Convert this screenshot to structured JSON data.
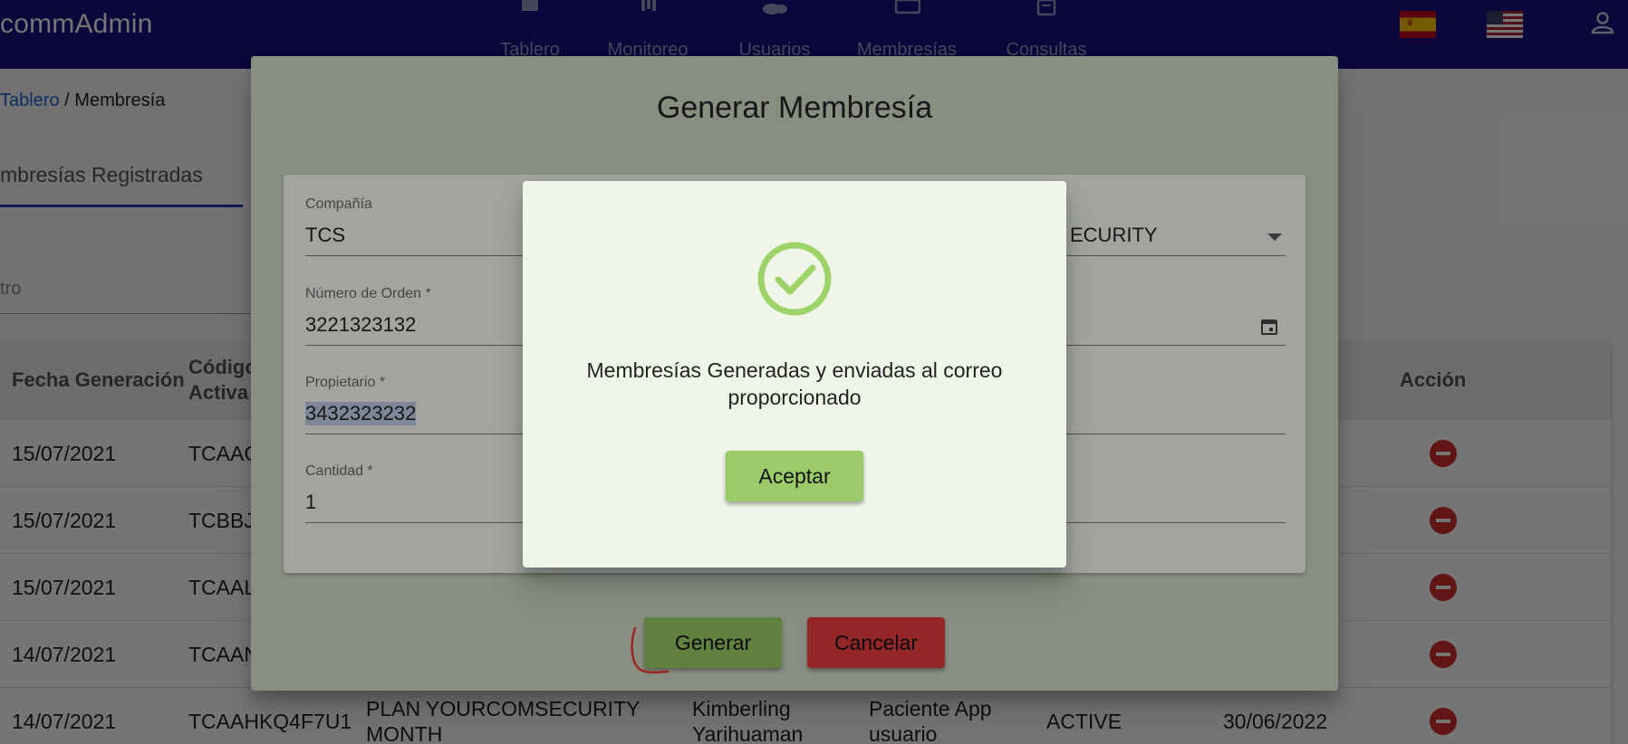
{
  "appbar": {
    "brand": "commAdmin",
    "nav": [
      {
        "label": "Tablero",
        "icon": "home-icon"
      },
      {
        "label": "Monitoreo",
        "icon": "bar-chart-icon"
      },
      {
        "label": "Usuarios",
        "icon": "people-icon"
      },
      {
        "label": "Membresías",
        "icon": "card-icon"
      },
      {
        "label": "Consultas",
        "icon": "clipboard-icon"
      }
    ],
    "languages": [
      {
        "name": "es",
        "icon": "spain-flag-icon"
      },
      {
        "name": "en",
        "icon": "usa-flag-icon"
      }
    ],
    "user_icon": "account-icon",
    "color": "#1a1080"
  },
  "breadcrumb": {
    "link": "Tablero",
    "separator": " / ",
    "current": "Membresía"
  },
  "page": {
    "tab_label": "mbresías Registradas",
    "filter_placeholder": "tro"
  },
  "table": {
    "headers": {
      "fecha": "Fecha Generación",
      "codigo": "Código\nActiva",
      "accion": "Acción"
    },
    "rows": [
      {
        "fecha": "15/07/2021",
        "codigo": "TCAAC",
        "plan": "",
        "propietario": "",
        "tipo": "",
        "estado": "",
        "vence": ""
      },
      {
        "fecha": "15/07/2021",
        "codigo": "TCBBJ",
        "plan": "",
        "propietario": "",
        "tipo": "",
        "estado": "",
        "vence": ""
      },
      {
        "fecha": "15/07/2021",
        "codigo": "TCAAL",
        "plan": "",
        "propietario": "",
        "tipo": "",
        "estado": "",
        "vence": ""
      },
      {
        "fecha": "14/07/2021",
        "codigo": "TCAAN",
        "plan": "",
        "propietario": "",
        "tipo": "",
        "estado": "",
        "vence": ""
      },
      {
        "fecha": "14/07/2021",
        "codigo": "TCAAHKQ4F7U1",
        "plan": "PLAN YOURCOMSECURITY\nMONTH",
        "propietario": "Kimberling\nYarihuaman",
        "tipo": "Paciente App\nusuario",
        "estado": "ACTIVE",
        "vence": "30/06/2022"
      }
    ]
  },
  "dialog": {
    "title": "Generar Membresía",
    "fields": {
      "compania": {
        "label": "Compañía",
        "value": "TCS"
      },
      "plan": {
        "value": "ECURITY"
      },
      "orden": {
        "label": "Número de Orden *",
        "value": "3221323132"
      },
      "propietario": {
        "label": "Propietario *",
        "value": "3432323232"
      },
      "cantidad": {
        "label": "Cantidad *",
        "value": "1"
      }
    },
    "generar_label": "Generar",
    "cancelar_label": "Cancelar"
  },
  "alert": {
    "message": "Membresías Generadas y enviadas al correo proporcionado",
    "accept_label": "Aceptar",
    "icon": "check-circle-icon",
    "icon_color": "#9ed36a"
  }
}
